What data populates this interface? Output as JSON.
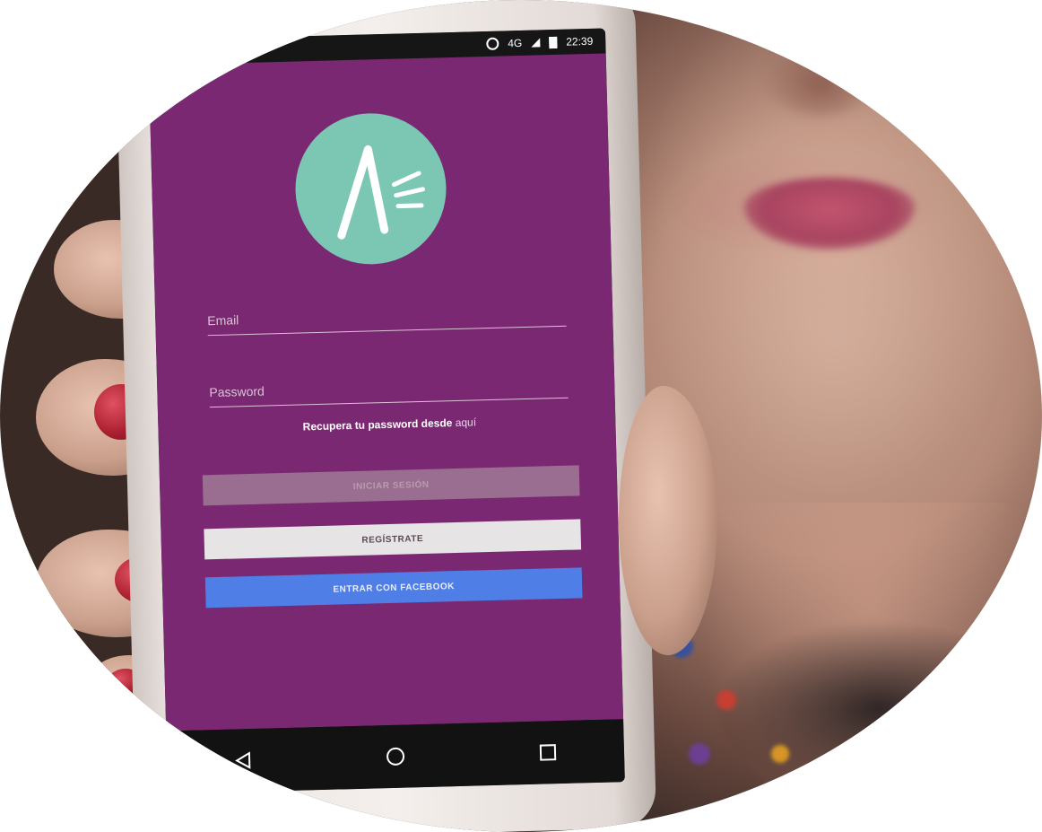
{
  "status_bar": {
    "network": "4G",
    "time": "22:39"
  },
  "login_form": {
    "email_placeholder": "Email",
    "password_placeholder": "Password",
    "recover_text": "Recupera tu password desde",
    "recover_link": "aquí",
    "login_button": "INICIAR SESIÓN",
    "register_button": "REGÍSTRATE",
    "facebook_button": "ENTRAR CON FACEBOOK"
  },
  "colors": {
    "app_background": "#7a2871",
    "logo_circle": "#7cc6b4",
    "facebook_button": "#4f7fe6",
    "register_button": "#e7e4e6",
    "login_button_disabled": "#9a6e90"
  },
  "icons": {
    "logo": "letter-a-logo",
    "nav_back": "triangle-back-icon",
    "nav_home": "circle-home-icon",
    "nav_recents": "square-recents-icon"
  }
}
